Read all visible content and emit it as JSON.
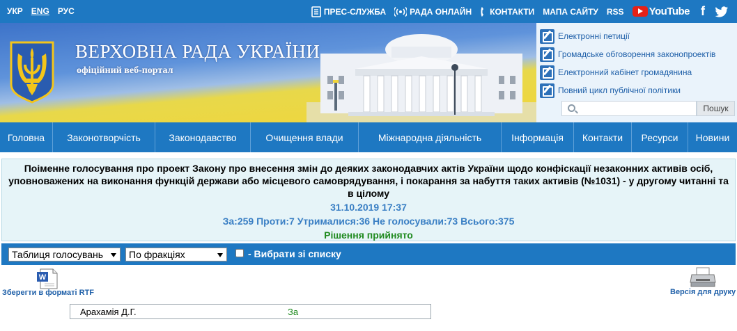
{
  "topbar": {
    "languages": [
      {
        "label": "УКР",
        "active": false
      },
      {
        "label": "ENG",
        "active": true
      },
      {
        "label": "РУС",
        "active": false
      }
    ],
    "press": "ПРЕС-СЛУЖБА",
    "online": "РАДА ОНЛАЙН",
    "contacts": "КОНТАКТИ",
    "sitemap": "МАПА САЙТУ",
    "rss": "RSS",
    "youtube": "YouTube",
    "facebook": "f",
    "twitter_icon": "twitter-icon"
  },
  "header": {
    "title": "ВЕРХОВНА РАДА УКРАЇНИ",
    "subtitle": "офіційний веб-портал",
    "side_links": [
      "Електронні петиції",
      "Громадське обговорення законопроектів",
      "Електронний кабінет громадянина",
      "Повний цикл публічної політики"
    ],
    "search_placeholder": "",
    "search_button": "Пошук"
  },
  "nav": [
    {
      "label": "Головна"
    },
    {
      "label": "Законотворчість"
    },
    {
      "label": "Законодавство"
    },
    {
      "label": "Очищення влади"
    },
    {
      "label": "Міжнародна діяльність"
    },
    {
      "label": "Інформація"
    },
    {
      "label": "Контакти"
    },
    {
      "label": "Ресурси"
    },
    {
      "label": "Новини"
    }
  ],
  "vote": {
    "title": "Поіменне голосування про проект Закону про внесення змін до деяких законодавчих актів України щодо конфіскації незаконних активів осіб, уповноважених на виконання функцій держави або місцевого самоврядування, і покарання за набуття таких активів (№1031) - у другому читанні та в цілому",
    "datetime": "31.10.2019 17:37",
    "results": "За:259 Проти:7 Утрималися:36 Не голосували:73 Всього:375",
    "decision": "Рішення прийнято"
  },
  "filters": {
    "view_select": "Таблиця голосувань",
    "group_select": "По фракціях",
    "checkbox_label": "- Вибрати зі списку"
  },
  "actions": {
    "rtf_label": "Зберегти в форматі RTF",
    "print_label": "Версія для друку"
  },
  "table": {
    "rows": [
      {
        "name": "Арахамія Д.Г.",
        "vote": "За"
      }
    ]
  },
  "colors": {
    "brand_blue": "#1e78c2",
    "link_blue": "#1e5fa8",
    "accept_green": "#1f8a1f",
    "vote_bg": "#e6f4f8"
  }
}
